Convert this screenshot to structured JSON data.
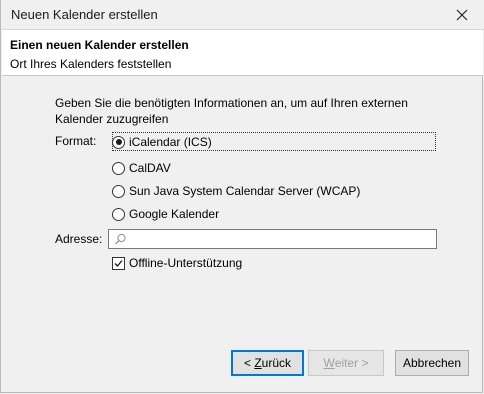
{
  "window": {
    "title": "Neuen Kalender erstellen"
  },
  "header": {
    "title": "Einen neuen Kalender erstellen",
    "subtitle": "Ort Ihres Kalenders feststellen"
  },
  "intro_text": "Geben Sie die benötigten Informationen an, um auf Ihren externen Kalender zuzugreifen",
  "format": {
    "label": "Format:",
    "selected": "iCalendar (ICS)",
    "options": [
      "iCalendar (ICS)",
      "CalDAV",
      "Sun Java System Calendar Server (WCAP)",
      "Google Kalender"
    ]
  },
  "address": {
    "label": "Adresse:",
    "value": "",
    "icon": "search-icon"
  },
  "offline": {
    "label": "Offline-Unterstützung",
    "checked": true
  },
  "buttons": {
    "back_prefix": "< ",
    "back_mnemonic": "Z",
    "back_rest": "urück",
    "next_mnemonic": "W",
    "next_rest": "eiter >",
    "cancel": "Abbrechen"
  },
  "colors": {
    "accent": "#0078d7",
    "dialog_bg": "#f0f0f0",
    "header_bg": "#ffffff"
  }
}
